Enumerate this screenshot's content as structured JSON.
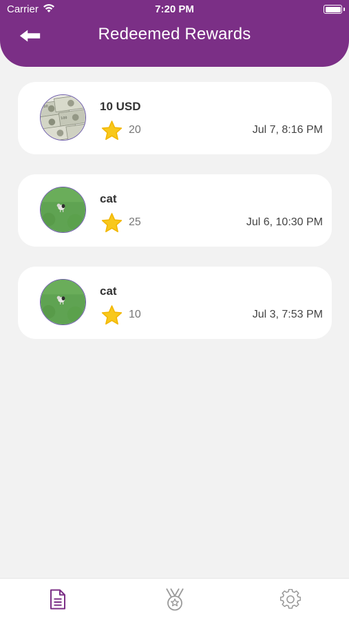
{
  "status_bar": {
    "carrier": "Carrier",
    "time": "7:20 PM"
  },
  "header": {
    "title": "Redeemed Rewards",
    "back_icon": "arrow-left-icon"
  },
  "colors": {
    "brand": "#7b2f86",
    "star": "#f8c81c",
    "tab_active": "#7b2f86",
    "tab_inactive": "#9a9a9a"
  },
  "rewards": [
    {
      "name": "10 USD",
      "points": "20",
      "date": "Jul 7, 8:16 PM",
      "image": "dollar-bills-image"
    },
    {
      "name": "cat",
      "points": "25",
      "date": "Jul 6, 10:30 PM",
      "image": "cat-on-grass-image"
    },
    {
      "name": "cat",
      "points": "10",
      "date": "Jul 3, 7:53 PM",
      "image": "cat-on-grass-image"
    }
  ],
  "tabbar": {
    "tabs": [
      {
        "icon": "document-icon",
        "active": true
      },
      {
        "icon": "medal-icon",
        "active": false
      },
      {
        "icon": "gear-icon",
        "active": false
      }
    ]
  }
}
